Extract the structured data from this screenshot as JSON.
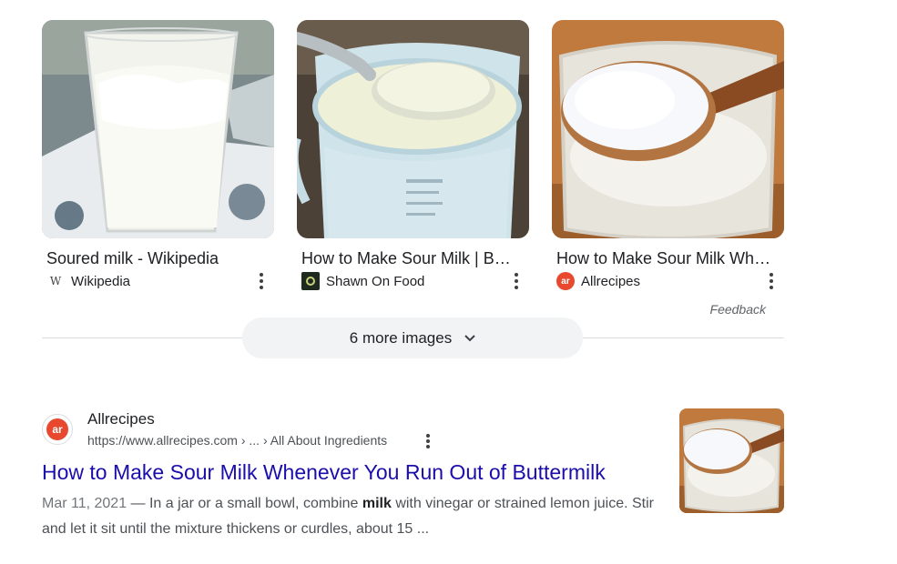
{
  "image_results": [
    {
      "title": "Soured milk - Wikipedia",
      "source": "Wikipedia",
      "source_icon": "wikipedia-w-icon"
    },
    {
      "title": "How to Make Sour Milk | Butt…",
      "source": "Shawn On Food",
      "source_icon": "shawn-on-food-icon"
    },
    {
      "title": "How to Make Sour Milk Whe…",
      "source": "Allrecipes",
      "source_icon": "allrecipes-icon"
    }
  ],
  "wiki_glyph": "W",
  "ar_glyph": "ar",
  "feedback_label": "Feedback",
  "more_images_label": "6 more images",
  "result": {
    "site_name": "Allrecipes",
    "url": "https://www.allrecipes.com › ... › All About Ingredients",
    "title": "How to Make Sour Milk Whenever You Run Out of Buttermilk",
    "date": "Mar 11, 2021",
    "dash": " — ",
    "snippet_pre": "In a jar or a small bowl, combine ",
    "snippet_bold": "milk",
    "snippet_post": " with vinegar or strained lemon juice. Stir and let it sit until the mixture thickens or curdles, about 15 ...",
    "favicon_glyph": "ar"
  },
  "colors": {
    "link": "#1a0dab",
    "allrecipes_brand": "#e8492e",
    "pill_bg": "#f1f3f4"
  }
}
